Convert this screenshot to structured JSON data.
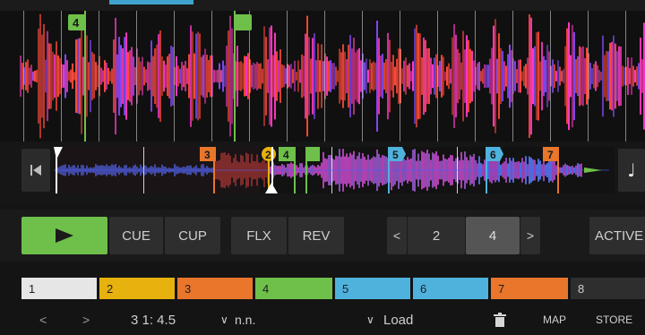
{
  "colors": {
    "play_green": "#6ec04a",
    "cue_white": "#e6e6e6",
    "cue_yellow": "#e7b10e",
    "cue_orange": "#e9762b",
    "cue_green": "#6ec04a",
    "cue_blue": "#4fb2dd",
    "wave_red": "#ff4a3a",
    "wave_magenta": "#ff3ac2",
    "wave_violet": "#8c4dff"
  },
  "main_waveform": {
    "markers": [
      {
        "label": "4",
        "color": "#6ec04a"
      },
      {
        "label": "",
        "color": "#6ec04a"
      }
    ]
  },
  "overview": {
    "markers": [
      {
        "label": "3",
        "color": "#e9762b"
      },
      {
        "label": "2",
        "color": "#e7b10e"
      },
      {
        "label": "4",
        "color": "#6ec04a"
      },
      {
        "label": "",
        "color": "#6ec04a"
      },
      {
        "label": "5",
        "color": "#4fb2dd"
      },
      {
        "label": "6",
        "color": "#4fb2dd"
      },
      {
        "label": "7",
        "color": "#e9762b"
      }
    ],
    "back_icon": "skip-to-start-icon",
    "note_icon": "music-note-icon"
  },
  "transport": {
    "play_icon": "play-icon",
    "cue": "CUE",
    "cup": "CUP",
    "flx": "FLX",
    "rev": "REV",
    "prev": "<",
    "jump_a": "2",
    "jump_b": "4",
    "next": ">",
    "active": "ACTIVE"
  },
  "hotcues": [
    {
      "label": "1",
      "color": "#e6e6e6"
    },
    {
      "label": "2",
      "color": "#e7b10e"
    },
    {
      "label": "3",
      "color": "#e9762b"
    },
    {
      "label": "4",
      "color": "#6ec04a"
    },
    {
      "label": "5",
      "color": "#4fb2dd"
    },
    {
      "label": "6",
      "color": "#4fb2dd"
    },
    {
      "label": "7",
      "color": "#e9762b"
    },
    {
      "label": "8",
      "color": "#2e2e2e"
    }
  ],
  "status": {
    "prev": "<",
    "next": ">",
    "position": "3 1: 4.5",
    "key_chevron": "∨",
    "key": "n.n.",
    "load_chevron": "∨",
    "load": "Load",
    "trash_icon": "trash-icon",
    "map": "MAP",
    "store": "STORE"
  }
}
